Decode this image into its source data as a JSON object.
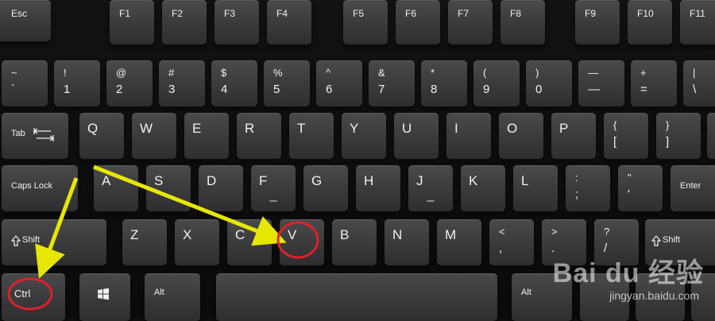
{
  "image": {
    "subject": "Close-up of a black computer keyboard",
    "annotation_color": "#e0e000",
    "circle_color": "#e0202a"
  },
  "keys": {
    "esc": "Esc",
    "f1": "F1",
    "f2": "F2",
    "f3": "F3",
    "f4": "F4",
    "f5": "F5",
    "f6": "F6",
    "f7": "F7",
    "f8": "F8",
    "f9": "F9",
    "f10": "F10",
    "f11": "F11",
    "backquote": {
      "top": "~",
      "bottom": "`"
    },
    "n1": {
      "top": "!",
      "bottom": "1"
    },
    "n2": {
      "top": "@",
      "bottom": "2"
    },
    "n3": {
      "top": "#",
      "bottom": "3"
    },
    "n4": {
      "top": "$",
      "bottom": "4"
    },
    "n5": {
      "top": "%",
      "bottom": "5"
    },
    "n6": {
      "top": "^",
      "bottom": "6"
    },
    "n7": {
      "top": "&",
      "bottom": "7"
    },
    "n8": {
      "top": "*",
      "bottom": "8"
    },
    "n9": {
      "top": "(",
      "bottom": "9"
    },
    "n0": {
      "top": ")",
      "bottom": "0"
    },
    "minus": {
      "top": "—",
      "bottom": "—"
    },
    "plus": {
      "top": "+",
      "bottom": "="
    },
    "backslash": {
      "top": "|",
      "bottom": "\\"
    },
    "tab": "Tab",
    "q": "Q",
    "w": "W",
    "e": "E",
    "r": "R",
    "t": "T",
    "y": "Y",
    "u": "U",
    "i": "I",
    "o": "O",
    "p": "P",
    "lbrace": {
      "top": "{",
      "bottom": "["
    },
    "rbrace": {
      "top": "}",
      "bottom": "]"
    },
    "caps": "Caps Lock",
    "a": "A",
    "s": "S",
    "d": "D",
    "f": "F",
    "g": "G",
    "h": "H",
    "j": "J",
    "k": "K",
    "l": "L",
    "semicolon": {
      "top": ":",
      "bottom": ";"
    },
    "quote": {
      "top": "\"",
      "bottom": "'"
    },
    "enter": "Enter",
    "lshift": "Shift",
    "z": "Z",
    "x": "X",
    "c": "C",
    "v": "V",
    "b": "B",
    "n": "N",
    "m": "M",
    "comma": {
      "top": "<",
      "bottom": ","
    },
    "period": {
      "top": ">",
      "bottom": "."
    },
    "slash": {
      "top": "?",
      "bottom": "/"
    },
    "rshift": "Shift",
    "ctrl": "Ctrl",
    "alt": "Alt",
    "altr": "Alt"
  },
  "watermark": {
    "logo": "Bai du 经验",
    "url": "jingyan.baidu.com"
  }
}
